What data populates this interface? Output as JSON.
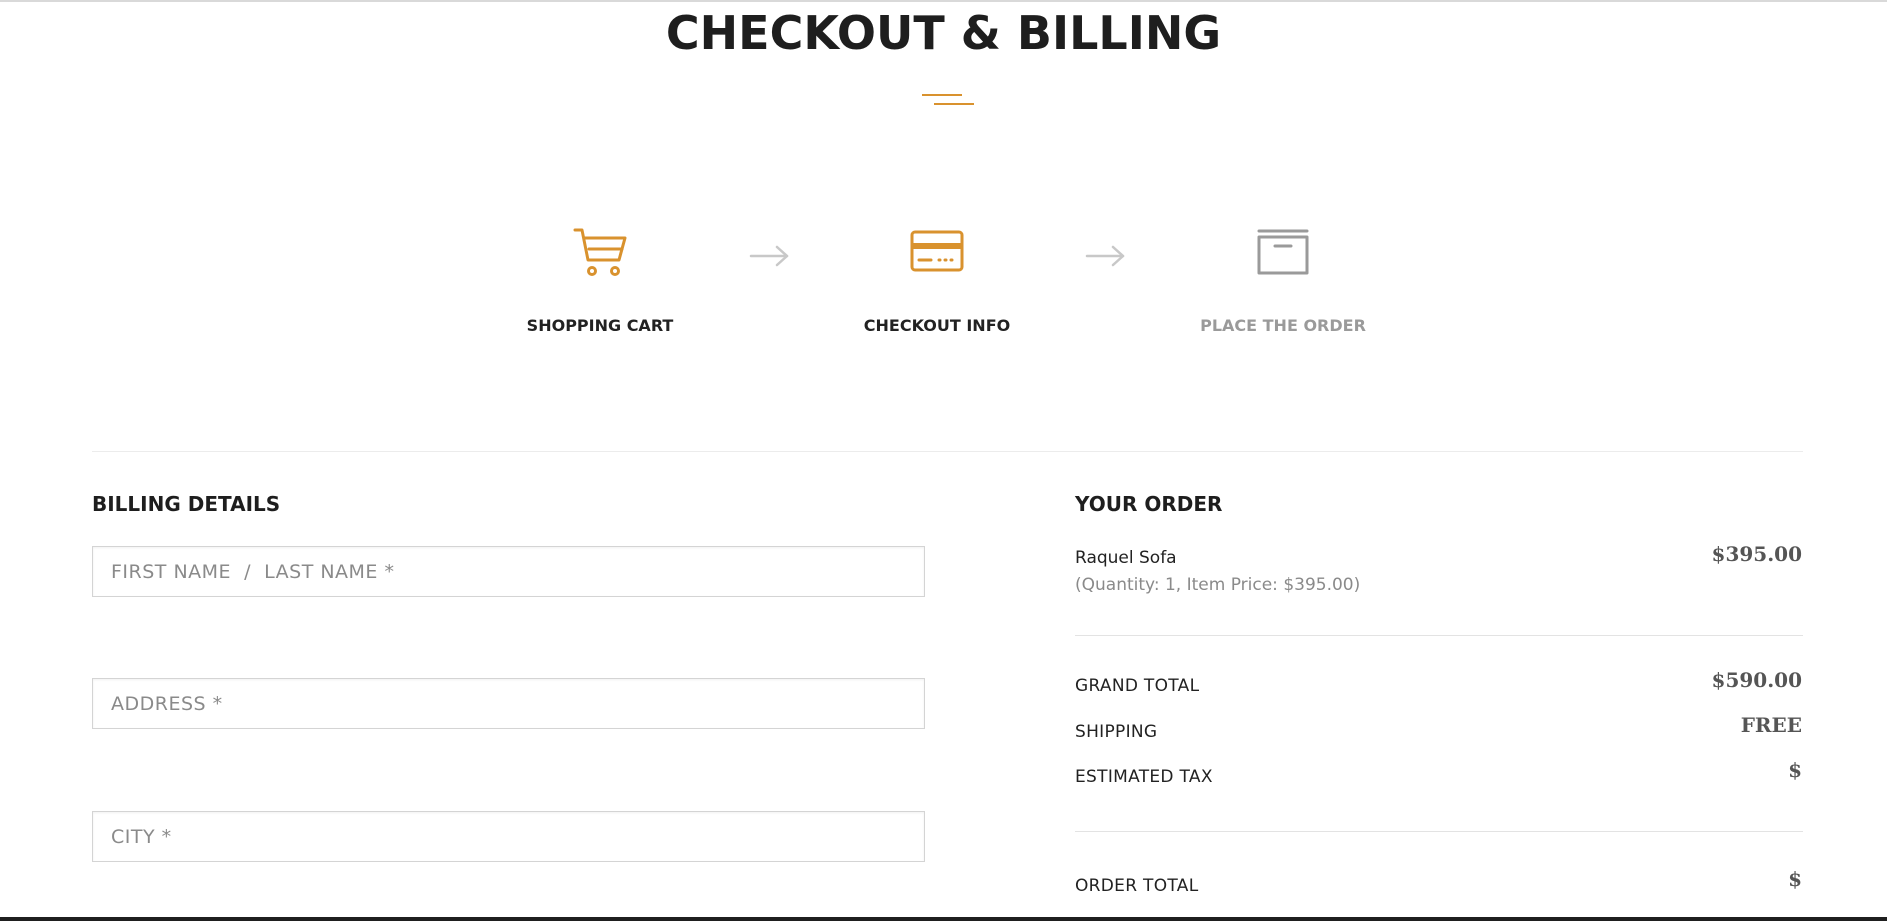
{
  "page": {
    "title": "CHECKOUT & BILLING",
    "accent_color": "#d9922e"
  },
  "steps": [
    {
      "label": "SHOPPING CART",
      "icon": "shopping-cart-icon",
      "state": "done"
    },
    {
      "label": "CHECKOUT INFO",
      "icon": "credit-card-icon",
      "state": "active"
    },
    {
      "label": "PLACE THE ORDER",
      "icon": "archive-box-icon",
      "state": "inactive"
    }
  ],
  "billing": {
    "heading": "BILLING DETAILS",
    "fields": {
      "name_placeholder": "FIRST NAME  /  LAST NAME *",
      "address_placeholder": "ADDRESS *",
      "city_placeholder": "CITY *"
    }
  },
  "order": {
    "heading": "YOUR ORDER",
    "item": {
      "name": "Raquel Sofa",
      "meta": "(Quantity: 1, Item Price: $395.00)",
      "price": "$395.00"
    },
    "grand_total_label": "GRAND TOTAL",
    "grand_total_value": "$590.00",
    "shipping_label": "SHIPPING",
    "shipping_value": "FREE",
    "tax_label": "ESTIMATED TAX",
    "tax_value": "$",
    "order_total_label": "ORDER TOTAL",
    "order_total_value": "$"
  }
}
